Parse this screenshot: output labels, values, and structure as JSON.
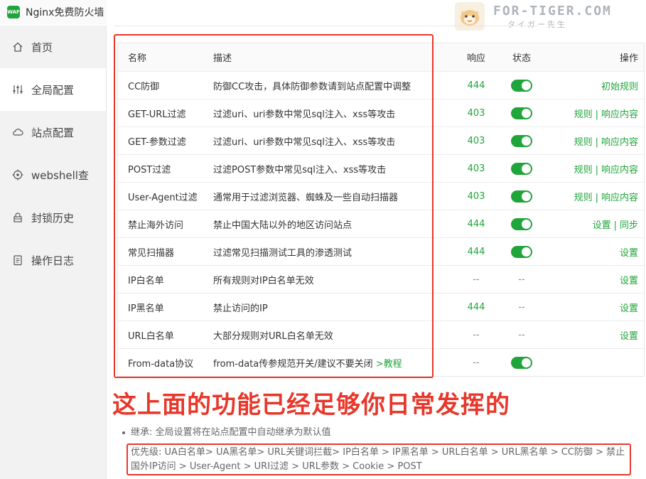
{
  "app": {
    "title": "Nginx免费防火墙",
    "logo_text": "WAF"
  },
  "watermark": {
    "main": "FOR-TIGER.COM",
    "sub": "タイガー先生"
  },
  "sidebar": {
    "items": [
      {
        "label": "首页",
        "icon": "home-icon",
        "active": false
      },
      {
        "label": "全局配置",
        "icon": "sliders-icon",
        "active": true
      },
      {
        "label": "站点配置",
        "icon": "cloud-icon",
        "active": false
      },
      {
        "label": "webshell查",
        "icon": "target-icon",
        "active": false
      },
      {
        "label": "封锁历史",
        "icon": "lock-icon",
        "active": false
      },
      {
        "label": "操作日志",
        "icon": "log-icon",
        "active": false
      }
    ]
  },
  "table": {
    "headers": {
      "name": "名称",
      "desc": "描述",
      "resp": "响应",
      "status": "状态",
      "ops": "操作"
    },
    "rows": [
      {
        "name": "CC防御",
        "desc": "防御CC攻击，具体防御参数请到站点配置中调整",
        "desc_link": "",
        "resp": "444",
        "status": "on",
        "ops": [
          "初始规则"
        ]
      },
      {
        "name": "GET-URL过滤",
        "desc": "过滤uri、uri参数中常见sql注入、xss等攻击",
        "desc_link": "",
        "resp": "403",
        "status": "on",
        "ops": [
          "规则",
          "响应内容"
        ]
      },
      {
        "name": "GET-参数过滤",
        "desc": "过滤uri、uri参数中常见sql注入、xss等攻击",
        "desc_link": "",
        "resp": "403",
        "status": "on",
        "ops": [
          "规则",
          "响应内容"
        ]
      },
      {
        "name": "POST过滤",
        "desc": "过滤POST参数中常见sql注入、xss等攻击",
        "desc_link": "",
        "resp": "403",
        "status": "on",
        "ops": [
          "规则",
          "响应内容"
        ]
      },
      {
        "name": "User-Agent过滤",
        "desc": "通常用于过滤浏览器、蜘蛛及一些自动扫描器",
        "desc_link": "",
        "resp": "403",
        "status": "on",
        "ops": [
          "规则",
          "响应内容"
        ]
      },
      {
        "name": "禁止海外访问",
        "desc": "禁止中国大陆以外的地区访问站点",
        "desc_link": "",
        "resp": "444",
        "status": "on",
        "ops": [
          "设置",
          "同步"
        ]
      },
      {
        "name": "常见扫描器",
        "desc": "过滤常见扫描测试工具的渗透测试",
        "desc_link": "",
        "resp": "444",
        "status": "on",
        "ops": [
          "设置"
        ]
      },
      {
        "name": "IP白名单",
        "desc": "所有规则对IP白名单无效",
        "desc_link": "",
        "resp": "--",
        "status": "--",
        "ops": [
          "设置"
        ]
      },
      {
        "name": "IP黑名单",
        "desc": "禁止访问的IP",
        "desc_link": "",
        "resp": "444",
        "status": "--",
        "ops": [
          "设置"
        ]
      },
      {
        "name": "URL白名单",
        "desc": "大部分规则对URL白名单无效",
        "desc_link": "",
        "resp": "--",
        "status": "--",
        "ops": [
          "设置"
        ]
      },
      {
        "name": "From-data协议",
        "desc": "from-data传参规范开关/建议不要关闭 ",
        "desc_link": ">教程",
        "resp": "--",
        "status": "on",
        "ops": []
      }
    ]
  },
  "banner": "这上面的功能已经足够你日常发挥的",
  "notes": {
    "inherit": "继承: 全局设置将在站点配置中自动继承为默认值",
    "priority": "优先级: UA白名单> UA黑名单> URL关键词拦截> IP白名单 > IP黑名单 > URL白名单 > URL黑名单 > CC防御 > 禁止国外IP访问 > User-Agent > URI过滤 > URL参数 > Cookie > POST"
  },
  "colors": {
    "accent": "#20a53a",
    "highlight": "#e8372a"
  }
}
